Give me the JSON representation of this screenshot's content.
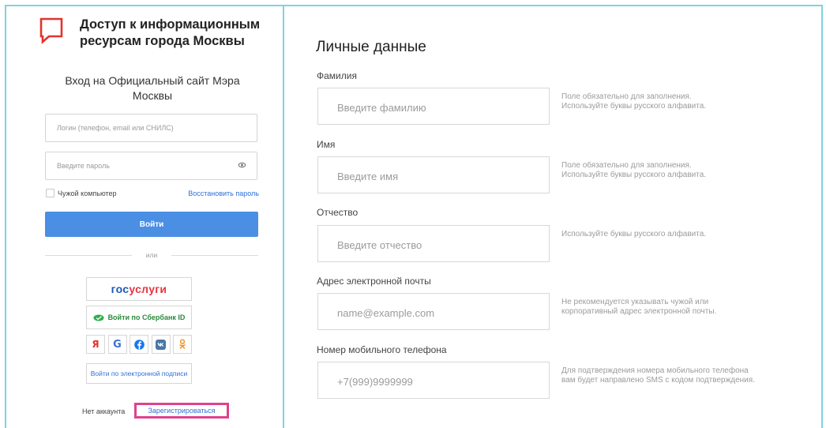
{
  "brand": {
    "line1": "Доступ к информационным",
    "line2": "ресурсам города Москвы",
    "logo_icon": "speech-bubble-logo-icon",
    "color": "#e1342c"
  },
  "login": {
    "subtitle_line1": "Вход на Официальный сайт Мэра",
    "subtitle_line2": "Москвы",
    "login_placeholder": "Логин (телефон, email или СНИЛС)",
    "password_placeholder": "Введите пароль",
    "foreign_computer": "Чужой компьютер",
    "restore_password": "Восстановить пароль",
    "submit": "Войти",
    "or": "или",
    "gosuslugi_a": "гос",
    "gosuslugi_b": "услуги",
    "sber": "Войти по Сбербанк ID",
    "socials": [
      {
        "name": "yandex",
        "glyph": "Я"
      },
      {
        "name": "google",
        "glyph": "G"
      },
      {
        "name": "facebook",
        "glyph": "f"
      },
      {
        "name": "vk",
        "glyph": "vk"
      },
      {
        "name": "odnoklassniki",
        "glyph": "ок"
      }
    ],
    "esign": "Войти по электронной подписи",
    "no_account": "Нет аккаунта",
    "register": "Зарегистрироваться",
    "accent": "#4a8fe4",
    "highlight": "#e0418c"
  },
  "personal": {
    "title": "Личные данные",
    "fields": [
      {
        "label": "Фамилия",
        "placeholder": "Введите фамилию",
        "hint1": "Поле обязательно для заполнения.",
        "hint2": "Используйте буквы русского алфавита."
      },
      {
        "label": "Имя",
        "placeholder": "Введите имя",
        "hint1": "Поле обязательно для заполнения.",
        "hint2": "Используйте буквы русского алфавита."
      },
      {
        "label": "Отчество",
        "placeholder": "Введите отчество",
        "hint1": "Используйте буквы русского алфавита.",
        "hint2": ""
      },
      {
        "label": "Адрес электронной почты",
        "placeholder": "name@example.com",
        "hint1": "Не рекомендуется указывать чужой или",
        "hint2": "корпоративный адрес электронной почты."
      },
      {
        "label": "Номер мобильного телефона",
        "placeholder": "+7(999)9999999",
        "hint1": "Для подтверждения номера мобильного телефона",
        "hint2": "вам будет направлено SMS с кодом подтверждения."
      }
    ]
  }
}
